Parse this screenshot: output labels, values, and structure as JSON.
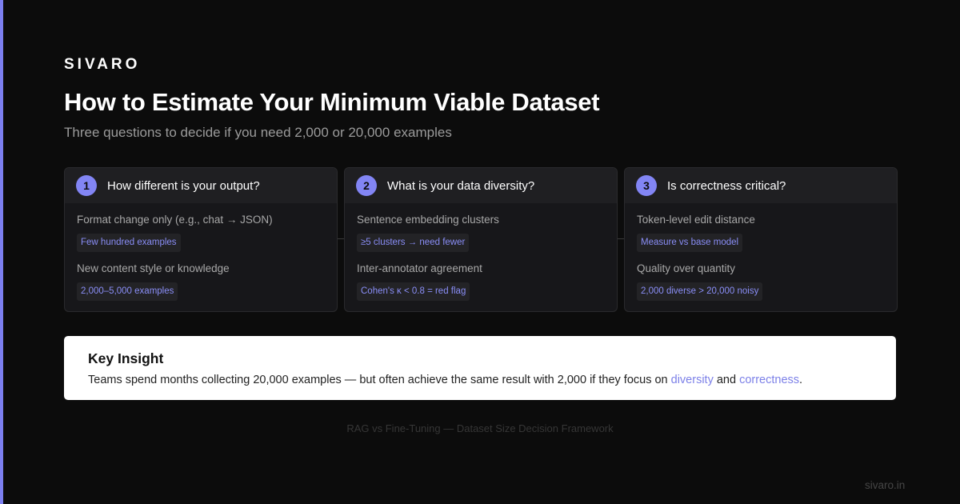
{
  "brand": "SIVARO",
  "title": "How to Estimate Your Minimum Viable Dataset",
  "subtitle": "Three questions to decide if you need 2,000 or 20,000 examples",
  "colors": {
    "accent": "#7c7ff0",
    "background": "#0c0c0c",
    "card": "#17171a",
    "tag_text": "#8a8ef7"
  },
  "steps": [
    {
      "number": "1",
      "title": "How different is your output?",
      "items": [
        {
          "label": "Format change only (e.g., chat → JSON)",
          "tag": "Few hundred examples"
        },
        {
          "label": "New content style or knowledge",
          "tag": "2,000–5,000 examples"
        }
      ]
    },
    {
      "number": "2",
      "title": "What is your data diversity?",
      "items": [
        {
          "label": "Sentence embedding clusters",
          "tag": "≥5 clusters → need fewer"
        },
        {
          "label": "Inter-annotator agreement",
          "tag": "Cohen's κ < 0.8 = red flag"
        }
      ]
    },
    {
      "number": "3",
      "title": "Is correctness critical?",
      "items": [
        {
          "label": "Token-level edit distance",
          "tag": "Measure vs base model"
        },
        {
          "label": "Quality over quantity",
          "tag": "2,000 diverse > 20,000 noisy"
        }
      ]
    }
  ],
  "insight": {
    "title": "Key Insight",
    "text_before": "Teams spend months collecting 20,000 examples — but often achieve the same result with 2,000 if they focus on ",
    "highlight1": "diversity",
    "text_middle": " and ",
    "highlight2": "correctness",
    "text_after": "."
  },
  "caption": "RAG vs Fine-Tuning — Dataset Size Decision Framework",
  "site": "sivaro.in"
}
